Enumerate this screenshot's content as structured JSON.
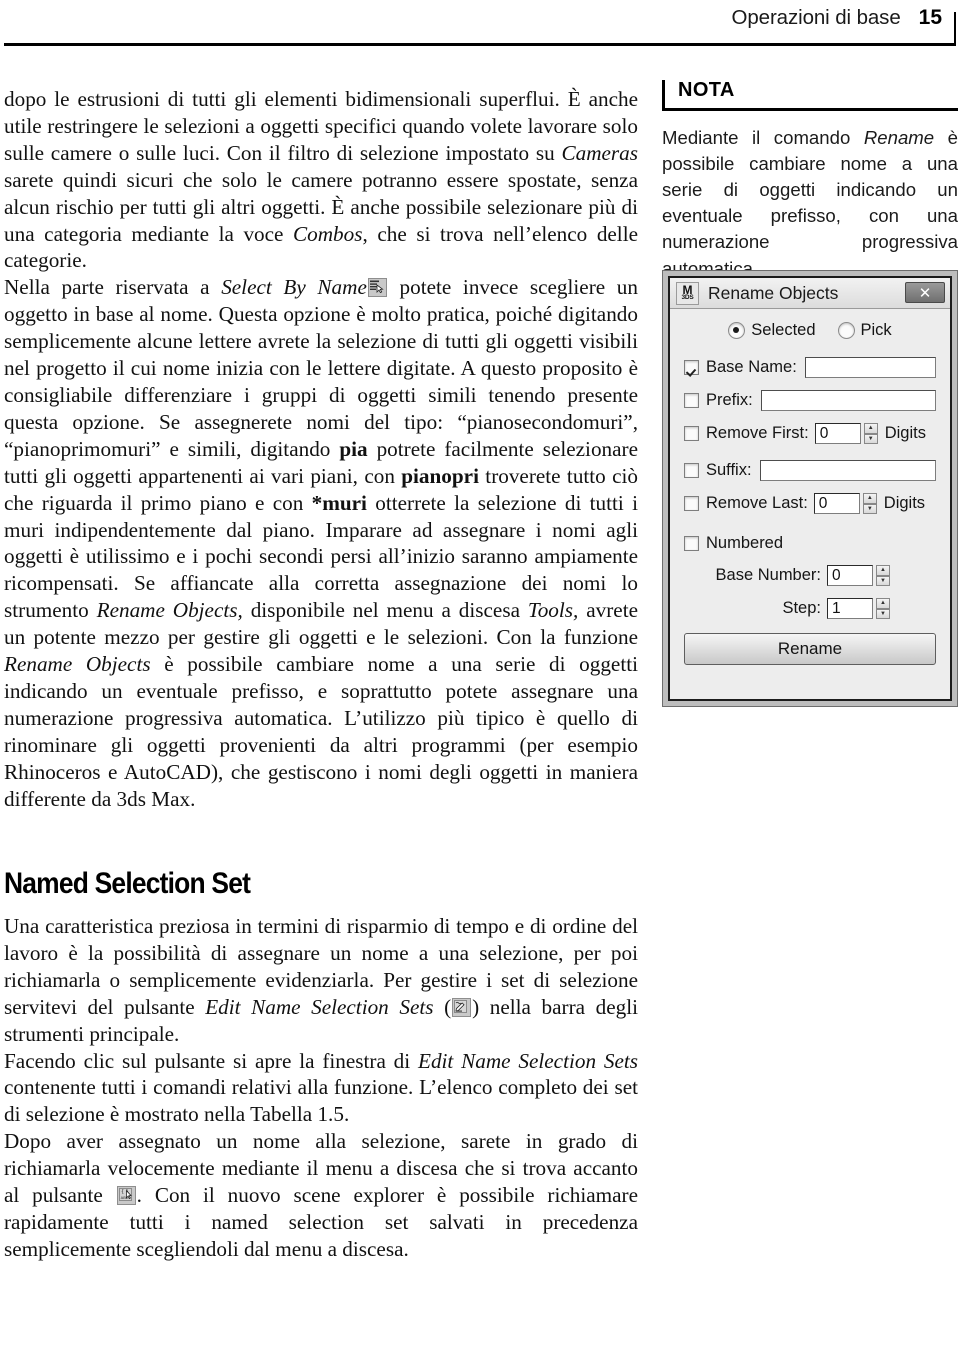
{
  "header": {
    "running_title": "Operazioni di base",
    "page_number": "15"
  },
  "main": {
    "paragraph1": {
      "s1": "dopo le estrusioni di tutti gli elementi bidimensionali superflui. È anche utile restringere le selezioni a oggetti specifici quando volete lavorare solo sulle camere o sulle luci. Con il filtro di selezione impostato su ",
      "i1": "Cameras",
      "s2": " sarete quindi sicuri che solo le camere potranno essere spostate, senza alcun rischio per tutti gli altri oggetti. È anche possibile selezionare più di una categoria mediante la voce ",
      "i2": "Combos",
      "s3": ", che si trova nell’elenco delle categorie."
    },
    "paragraph2": {
      "s1": "Nella parte riservata a ",
      "i1": "Select By Name",
      "s2": " potete invece scegliere un oggetto in base al nome. Questa opzione è molto pratica, poiché digitando semplicemente alcune lettere avrete la selezione di tutti gli oggetti visibili nel progetto il cui nome inizia con le lettere digitate. A questo proposito è consigliabile differenziare i gruppi di oggetti simili tenendo presente questa opzione. Se assegnerete nomi del tipo: “pianosecondomuri”, “pianoprimomuri” e simili, digitando ",
      "b1": "pia",
      "s3": " potrete facilmente selezionare tutti gli oggetti appartenenti ai vari piani, con ",
      "b2": "pianopri",
      "s4": " troverete tutto ciò che riguarda il primo piano e con ",
      "b3": "*muri",
      "s5": " otterrete la selezione di tutti i muri indipendentemente dal piano. Imparare ad assegnare i nomi agli oggetti è utilissimo e i pochi secondi persi all’inizio saranno ampiamente ricompensati. Se affiancate alla corretta assegnazione dei nomi lo strumento ",
      "i2": "Rename Objects,",
      "s6": " disponibile nel menu a discesa ",
      "i3": "Tools,",
      "s7": " avrete un potente mezzo per gestire gli oggetti e le selezioni. Con la funzione ",
      "i4": "Rename Objects",
      "s8": " è possibile cambiare nome a una serie di oggetti indicando un eventuale prefisso, e soprattutto potete assegnare una numerazione progressiva automatica. L’utilizzo più tipico è quello di rinominare gli oggetti provenienti da altri programmi (per esempio Rhinoceros e AutoCAD), che gestiscono i nomi degli oggetti in maniera differente da 3ds Max."
    },
    "section_heading": "Named Selection Set",
    "paragraph3": {
      "s1": "Una caratteristica preziosa in termini di risparmio di tempo e di ordine del lavoro è la possibilità di assegnare un nome a una selezione, per poi richiamarla o semplicemente evidenziarla. Per gestire i set di selezione servitevi del pulsante ",
      "i1": "Edit Name Selection Sets",
      "s2": " (",
      "s3": ") nella barra degli strumenti principale."
    },
    "paragraph4": {
      "s1": "Facendo clic sul pulsante si apre la finestra di ",
      "i1": "Edit Name Selection Sets",
      "s2": " contenente tutti i comandi relativi alla funzione. L’elenco completo dei set di selezione è mostrato nella Tabella 1.5."
    },
    "paragraph5": {
      "s1": "Dopo aver assegnato un nome alla selezione, sarete in grado di richiamarla velocemente mediante il menu a discesa che si trova accanto al pulsante ",
      "s2": ". Con il nuovo scene explorer è possibile richiamare rapidamente tutti i named selection set salvati in precedenza semplicemente scegliendoli dal menu a discesa."
    }
  },
  "nota": {
    "label": "NOTA",
    "text_before": "Mediante il comando ",
    "text_italic": "Rename",
    "text_after": " è possibile cambiare nome a una serie di oggetti indicando un eventuale prefisso, con una numerazione progressiva automatica."
  },
  "dialog": {
    "app_icon_top": "M",
    "app_icon_bottom": "3DS",
    "title": "Rename Objects",
    "close_label": "✕",
    "radio_selected": "Selected",
    "radio_pick": "Pick",
    "base_name_label": "Base Name:",
    "base_name_value": "",
    "prefix_label": "Prefix:",
    "prefix_value": "",
    "remove_first_label": "Remove First:",
    "remove_first_value": "0",
    "remove_first_digits": "Digits",
    "suffix_label": "Suffix:",
    "suffix_value": "",
    "remove_last_label": "Remove Last:",
    "remove_last_value": "0",
    "remove_last_digits": "Digits",
    "numbered_label": "Numbered",
    "base_number_label": "Base Number:",
    "base_number_value": "0",
    "step_label": "Step:",
    "step_value": "1",
    "rename_button": "Rename"
  },
  "icons": {
    "select_by_name": "select-by-name-icon",
    "edit_named_selection_sets": "edit-named-selection-sets-icon",
    "named_selection_dropdown": "named-selection-sets-icon"
  }
}
